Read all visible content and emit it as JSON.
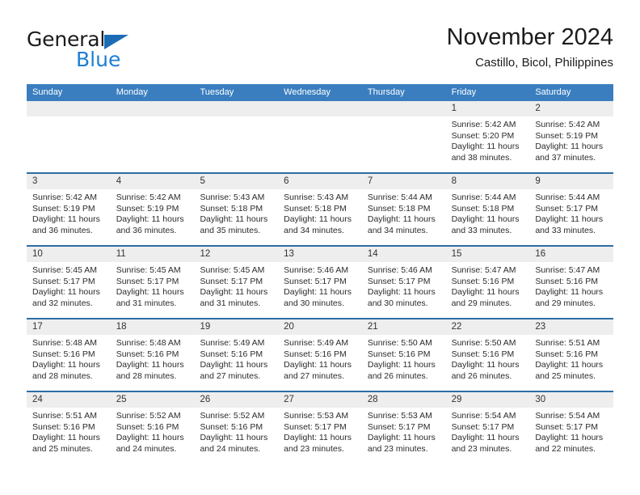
{
  "brand": {
    "name_part1": "General",
    "name_part2": "Blue",
    "triangle_color": "#1c6cb5",
    "blue_color": "#1d7fd4"
  },
  "header": {
    "title": "November 2024",
    "subtitle": "Castillo, Bicol, Philippines"
  },
  "theme": {
    "header_band": "#3a7ebf",
    "row_divider": "#2e6da4",
    "day_number_band": "#eeeeee"
  },
  "weekdays": [
    "Sunday",
    "Monday",
    "Tuesday",
    "Wednesday",
    "Thursday",
    "Friday",
    "Saturday"
  ],
  "weeks": [
    [
      {
        "day": "",
        "empty": true,
        "lines": []
      },
      {
        "day": "",
        "empty": true,
        "lines": []
      },
      {
        "day": "",
        "empty": true,
        "lines": []
      },
      {
        "day": "",
        "empty": true,
        "lines": []
      },
      {
        "day": "",
        "empty": true,
        "lines": []
      },
      {
        "day": "1",
        "empty": false,
        "lines": [
          "Sunrise: 5:42 AM",
          "Sunset: 5:20 PM",
          "Daylight: 11 hours",
          "and 38 minutes."
        ]
      },
      {
        "day": "2",
        "empty": false,
        "lines": [
          "Sunrise: 5:42 AM",
          "Sunset: 5:19 PM",
          "Daylight: 11 hours",
          "and 37 minutes."
        ]
      }
    ],
    [
      {
        "day": "3",
        "empty": false,
        "lines": [
          "Sunrise: 5:42 AM",
          "Sunset: 5:19 PM",
          "Daylight: 11 hours",
          "and 36 minutes."
        ]
      },
      {
        "day": "4",
        "empty": false,
        "lines": [
          "Sunrise: 5:42 AM",
          "Sunset: 5:19 PM",
          "Daylight: 11 hours",
          "and 36 minutes."
        ]
      },
      {
        "day": "5",
        "empty": false,
        "lines": [
          "Sunrise: 5:43 AM",
          "Sunset: 5:18 PM",
          "Daylight: 11 hours",
          "and 35 minutes."
        ]
      },
      {
        "day": "6",
        "empty": false,
        "lines": [
          "Sunrise: 5:43 AM",
          "Sunset: 5:18 PM",
          "Daylight: 11 hours",
          "and 34 minutes."
        ]
      },
      {
        "day": "7",
        "empty": false,
        "lines": [
          "Sunrise: 5:44 AM",
          "Sunset: 5:18 PM",
          "Daylight: 11 hours",
          "and 34 minutes."
        ]
      },
      {
        "day": "8",
        "empty": false,
        "lines": [
          "Sunrise: 5:44 AM",
          "Sunset: 5:18 PM",
          "Daylight: 11 hours",
          "and 33 minutes."
        ]
      },
      {
        "day": "9",
        "empty": false,
        "lines": [
          "Sunrise: 5:44 AM",
          "Sunset: 5:17 PM",
          "Daylight: 11 hours",
          "and 33 minutes."
        ]
      }
    ],
    [
      {
        "day": "10",
        "empty": false,
        "lines": [
          "Sunrise: 5:45 AM",
          "Sunset: 5:17 PM",
          "Daylight: 11 hours",
          "and 32 minutes."
        ]
      },
      {
        "day": "11",
        "empty": false,
        "lines": [
          "Sunrise: 5:45 AM",
          "Sunset: 5:17 PM",
          "Daylight: 11 hours",
          "and 31 minutes."
        ]
      },
      {
        "day": "12",
        "empty": false,
        "lines": [
          "Sunrise: 5:45 AM",
          "Sunset: 5:17 PM",
          "Daylight: 11 hours",
          "and 31 minutes."
        ]
      },
      {
        "day": "13",
        "empty": false,
        "lines": [
          "Sunrise: 5:46 AM",
          "Sunset: 5:17 PM",
          "Daylight: 11 hours",
          "and 30 minutes."
        ]
      },
      {
        "day": "14",
        "empty": false,
        "lines": [
          "Sunrise: 5:46 AM",
          "Sunset: 5:17 PM",
          "Daylight: 11 hours",
          "and 30 minutes."
        ]
      },
      {
        "day": "15",
        "empty": false,
        "lines": [
          "Sunrise: 5:47 AM",
          "Sunset: 5:16 PM",
          "Daylight: 11 hours",
          "and 29 minutes."
        ]
      },
      {
        "day": "16",
        "empty": false,
        "lines": [
          "Sunrise: 5:47 AM",
          "Sunset: 5:16 PM",
          "Daylight: 11 hours",
          "and 29 minutes."
        ]
      }
    ],
    [
      {
        "day": "17",
        "empty": false,
        "lines": [
          "Sunrise: 5:48 AM",
          "Sunset: 5:16 PM",
          "Daylight: 11 hours",
          "and 28 minutes."
        ]
      },
      {
        "day": "18",
        "empty": false,
        "lines": [
          "Sunrise: 5:48 AM",
          "Sunset: 5:16 PM",
          "Daylight: 11 hours",
          "and 28 minutes."
        ]
      },
      {
        "day": "19",
        "empty": false,
        "lines": [
          "Sunrise: 5:49 AM",
          "Sunset: 5:16 PM",
          "Daylight: 11 hours",
          "and 27 minutes."
        ]
      },
      {
        "day": "20",
        "empty": false,
        "lines": [
          "Sunrise: 5:49 AM",
          "Sunset: 5:16 PM",
          "Daylight: 11 hours",
          "and 27 minutes."
        ]
      },
      {
        "day": "21",
        "empty": false,
        "lines": [
          "Sunrise: 5:50 AM",
          "Sunset: 5:16 PM",
          "Daylight: 11 hours",
          "and 26 minutes."
        ]
      },
      {
        "day": "22",
        "empty": false,
        "lines": [
          "Sunrise: 5:50 AM",
          "Sunset: 5:16 PM",
          "Daylight: 11 hours",
          "and 26 minutes."
        ]
      },
      {
        "day": "23",
        "empty": false,
        "lines": [
          "Sunrise: 5:51 AM",
          "Sunset: 5:16 PM",
          "Daylight: 11 hours",
          "and 25 minutes."
        ]
      }
    ],
    [
      {
        "day": "24",
        "empty": false,
        "lines": [
          "Sunrise: 5:51 AM",
          "Sunset: 5:16 PM",
          "Daylight: 11 hours",
          "and 25 minutes."
        ]
      },
      {
        "day": "25",
        "empty": false,
        "lines": [
          "Sunrise: 5:52 AM",
          "Sunset: 5:16 PM",
          "Daylight: 11 hours",
          "and 24 minutes."
        ]
      },
      {
        "day": "26",
        "empty": false,
        "lines": [
          "Sunrise: 5:52 AM",
          "Sunset: 5:16 PM",
          "Daylight: 11 hours",
          "and 24 minutes."
        ]
      },
      {
        "day": "27",
        "empty": false,
        "lines": [
          "Sunrise: 5:53 AM",
          "Sunset: 5:17 PM",
          "Daylight: 11 hours",
          "and 23 minutes."
        ]
      },
      {
        "day": "28",
        "empty": false,
        "lines": [
          "Sunrise: 5:53 AM",
          "Sunset: 5:17 PM",
          "Daylight: 11 hours",
          "and 23 minutes."
        ]
      },
      {
        "day": "29",
        "empty": false,
        "lines": [
          "Sunrise: 5:54 AM",
          "Sunset: 5:17 PM",
          "Daylight: 11 hours",
          "and 23 minutes."
        ]
      },
      {
        "day": "30",
        "empty": false,
        "lines": [
          "Sunrise: 5:54 AM",
          "Sunset: 5:17 PM",
          "Daylight: 11 hours",
          "and 22 minutes."
        ]
      }
    ]
  ]
}
